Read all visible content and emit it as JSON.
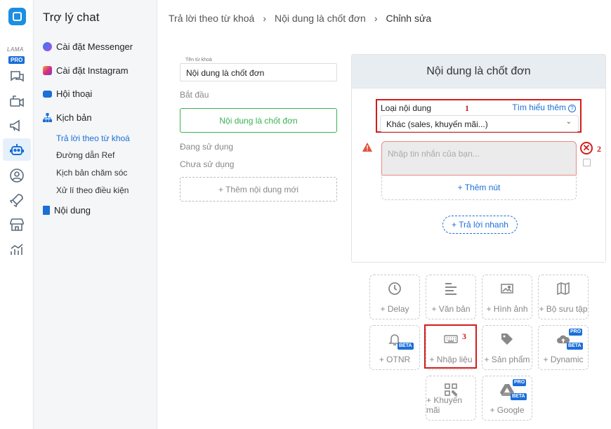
{
  "rail": {
    "lama": "LAMA",
    "pro": "PRO",
    "icons": [
      "logo-icon",
      "chat-icon",
      "camera-icon",
      "megaphone-icon",
      "bot-icon",
      "user-icon",
      "rocket-icon",
      "store-icon",
      "chart-icon"
    ]
  },
  "sidebar": {
    "title": "Trợ lý chat",
    "items": [
      {
        "label": "Cài đặt Messenger",
        "icon": "messenger-icon"
      },
      {
        "label": "Cài đặt Instagram",
        "icon": "instagram-icon"
      },
      {
        "label": "Hội thoại",
        "icon": "mail-icon"
      },
      {
        "label": "Kịch bản",
        "icon": "sitemap-icon"
      },
      {
        "label": "Nội dung",
        "icon": "document-icon"
      }
    ],
    "subitems": [
      {
        "label": "Trả lời theo từ khoá",
        "active": true
      },
      {
        "label": "Đường dẫn Ref",
        "active": false
      },
      {
        "label": "Kịch bản chăm sóc",
        "active": false
      },
      {
        "label": "Xử lí theo điều kiện",
        "active": false
      }
    ]
  },
  "breadcrumb": [
    "Trả lời theo từ khoá",
    "Nội dung là chốt đơn",
    "Chỉnh sửa"
  ],
  "keyword": {
    "field_label": "Tên từ khoá",
    "value": "Nội dung là chốt đơn",
    "start_label": "Bắt đầu",
    "content_button": "Nội dung là chốt đơn",
    "in_use": "Đang sử dụng",
    "unused": "Chưa sử dụng",
    "add_new": "+ Thêm nội dung mới"
  },
  "editor": {
    "title": "Nội dung là chốt đơn",
    "type_label": "Loại nội dung",
    "learn_more": "Tìm hiểu thêm",
    "qmark": "?",
    "type_value": "Khác (sales, khuyến mãi...)",
    "message_placeholder": "Nhập tin nhắn của bạn...",
    "add_button": "+ Thêm nút",
    "quick_reply": "+ Trả lời nhanh",
    "annotations": [
      "1",
      "2",
      "3"
    ]
  },
  "tiles": [
    {
      "label": "+ Delay",
      "icon": "clock-icon",
      "badge": ""
    },
    {
      "label": "+ Văn bản",
      "icon": "text-icon",
      "badge": ""
    },
    {
      "label": "+ Hình ảnh",
      "icon": "image-icon",
      "badge": ""
    },
    {
      "label": "+ Bộ sưu tập",
      "icon": "map-icon",
      "badge": ""
    },
    {
      "label": "+ OTNR",
      "icon": "bell-icon",
      "badge": "BETA"
    },
    {
      "label": "+ Nhập liệu",
      "icon": "keyboard-icon",
      "badge": ""
    },
    {
      "label": "+ Sản phẩm",
      "icon": "tag-icon",
      "badge": ""
    },
    {
      "label": "+ Dynamic",
      "icon": "cloud-icon",
      "badge": "PRO BETA"
    },
    {
      "label": "+ Khuyến mãi",
      "icon": "qr-icon",
      "badge": ""
    },
    {
      "label": "+ Google",
      "icon": "google-drive-icon",
      "badge": "PRO BETA"
    }
  ],
  "colors": {
    "accent": "#1a6fd8",
    "green": "#3cb054",
    "annotation_red": "#d21d1d"
  }
}
